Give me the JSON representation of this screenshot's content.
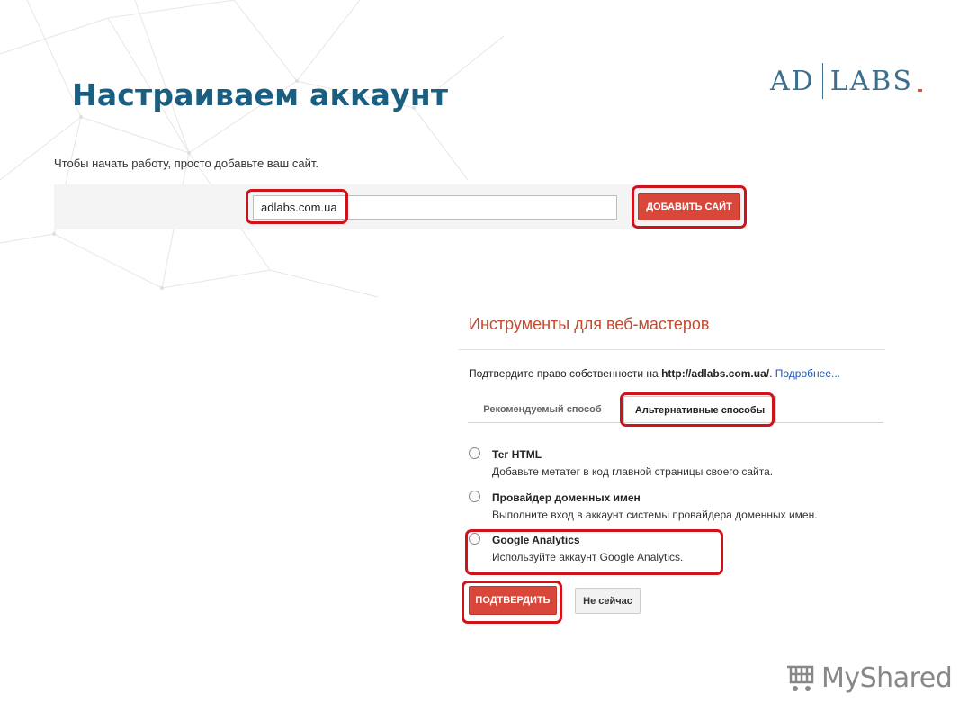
{
  "slide": {
    "title": "Настраиваем аккаунт"
  },
  "logo": {
    "left": "AD",
    "right": "LABS",
    "accent_color": "#e0522f",
    "color": "#3b6f8f"
  },
  "add_site": {
    "intro": "Чтобы начать работу, просто добавьте ваш сайт.",
    "input_value": "adlabs.com.ua",
    "button_label": "ДОБАВИТЬ САЙТ"
  },
  "webmaster": {
    "title": "Инструменты для веб-мастеров",
    "verify_prefix": "Подтвердите право собственности на ",
    "verify_url": "http://adlabs.com.ua/",
    "verify_suffix": ". ",
    "more_link": "Подробнее...",
    "tabs": [
      {
        "label": "Рекомендуемый способ",
        "active": false
      },
      {
        "label": "Альтернативные способы",
        "active": true
      }
    ],
    "options": [
      {
        "title": "Тег HTML",
        "desc": "Добавьте метатег в код главной страницы своего сайта."
      },
      {
        "title": "Провайдер доменных имен",
        "desc": "Выполните вход в аккаунт системы провайдера доменных имен."
      },
      {
        "title": "Google Analytics",
        "desc": "Используйте аккаунт Google Analytics."
      }
    ],
    "confirm_label": "ПОДТВЕРДИТЬ",
    "not_now_label": "Не сейчас"
  },
  "watermark": {
    "text": "MyShared",
    "icon": "cart-icon"
  },
  "colors": {
    "highlight": "#d0121a",
    "button_red": "#d9473a",
    "title_blue": "#1a5f82",
    "wmt_title": "#c44a2f"
  }
}
